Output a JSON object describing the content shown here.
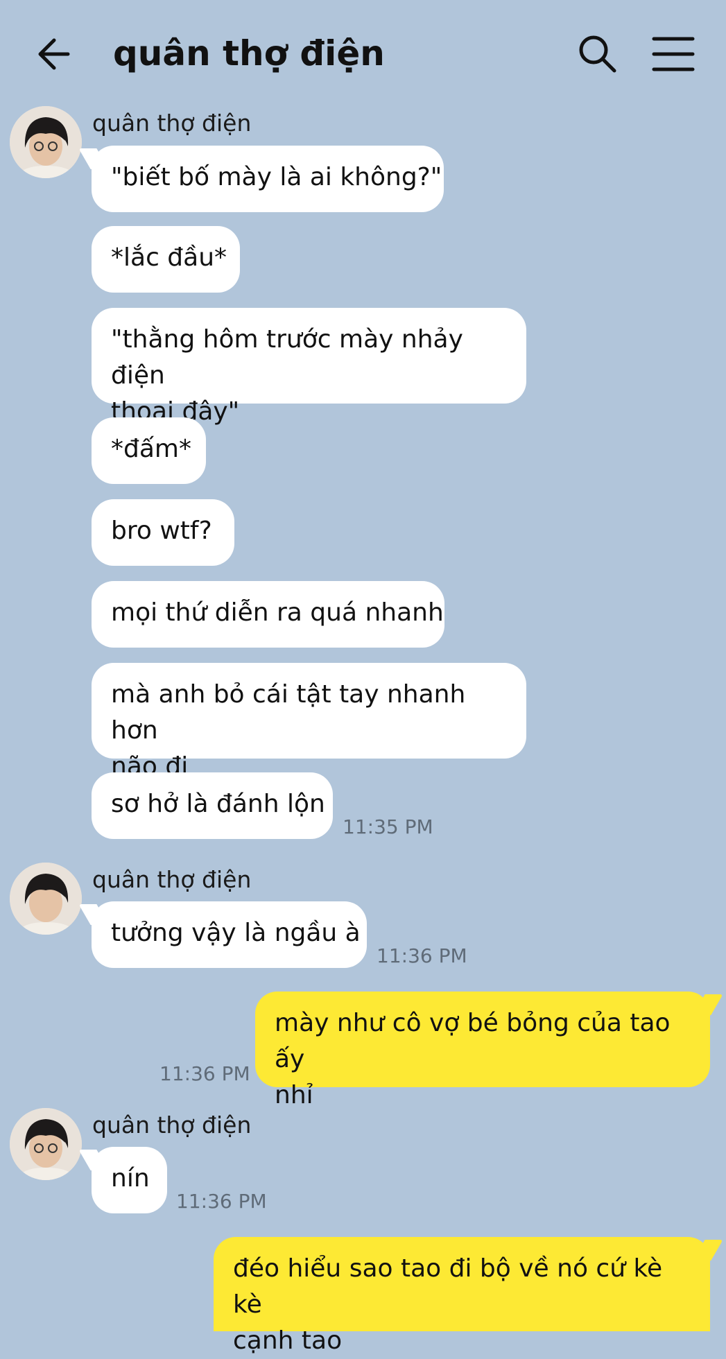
{
  "header": {
    "title": "quân thợ điện",
    "back_icon": "arrow-left-icon",
    "search_icon": "search-icon",
    "menu_icon": "hamburger-menu-icon"
  },
  "colors": {
    "background": "#b1c5da",
    "incoming_bubble": "#ffffff",
    "outgoing_bubble": "#fde934",
    "timestamp": "#5f6b78"
  },
  "messages": [
    {
      "sender": "quân thợ điện",
      "bubbles": [
        "\"biết bố mày là ai không?\"",
        "*lắc đầu*"
      ]
    },
    {
      "bubbles": [
        "\"thằng hôm trước mày nhảy điện",
        "thoại đây\""
      ]
    },
    {
      "bubbles": [
        "*đấm*",
        "bro wtf?",
        "mọi thứ diễn ra quá nhanh"
      ]
    },
    {
      "bubbles": [
        "mà anh bỏ cái tật tay nhanh hơn",
        "não đi"
      ]
    },
    {
      "bubbles": [
        "sơ hở là đánh lộn"
      ],
      "time": "11:35 PM"
    },
    {
      "sender": "quân thợ điện",
      "bubbles": [
        "tưởng vậy là ngầu à"
      ],
      "time": "11:36 PM"
    },
    {
      "bubbles": [
        "mày như cô vợ bé bỏng của tao ấy",
        "nhỉ"
      ],
      "time": "11:36 PM"
    },
    {
      "sender": "quân thợ điện",
      "bubbles": [
        "nín"
      ],
      "time": "11:36 PM"
    },
    {
      "bubbles": [
        "đéo hiểu sao tao đi bộ về nó cứ kè kè",
        "cạnh tao"
      ]
    }
  ]
}
